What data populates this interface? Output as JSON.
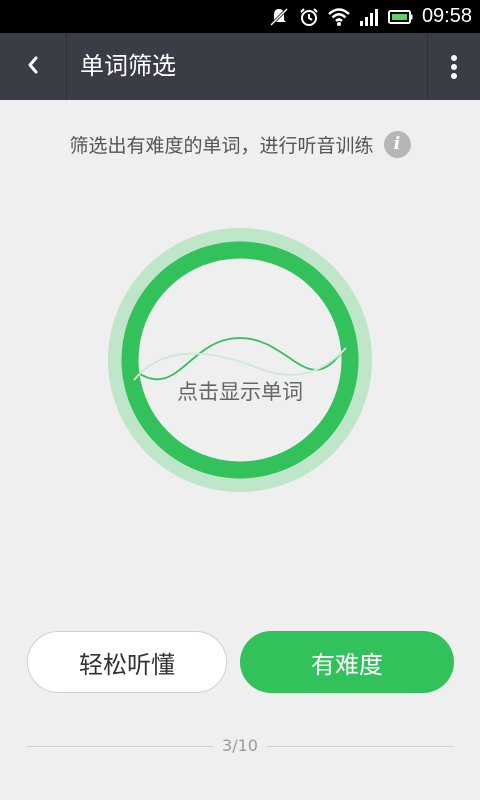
{
  "status_bar": {
    "time": "09:58",
    "icons": [
      "mute-icon",
      "alarm-icon",
      "wifi-icon",
      "signal-icon",
      "battery-icon"
    ]
  },
  "toolbar": {
    "title": "单词筛选",
    "back_icon": "chevron-left-icon",
    "more_icon": "overflow-menu-icon"
  },
  "main": {
    "subtitle": "筛选出有难度的单词，进行听音训练",
    "info_icon_glyph": "i",
    "circle_label": "点击显示单词"
  },
  "actions": {
    "easy_label": "轻松听懂",
    "hard_label": "有难度"
  },
  "progress": {
    "text": "3/10",
    "current": 3,
    "total": 10
  },
  "colors": {
    "accent": "#33c15c",
    "accent_light": "#bfe6c8",
    "toolbar": "#3a3d45",
    "background": "#efefef"
  }
}
